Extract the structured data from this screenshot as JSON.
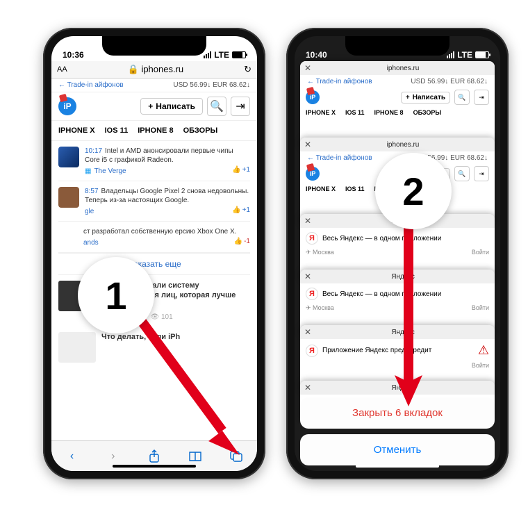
{
  "left": {
    "status_time": "10:36",
    "net": "LTE",
    "url_domain": "iphones.ru",
    "tradein_link": "← Trade-in айфонов",
    "rates": "USD 56.99↓ EUR 68.62↓",
    "write_btn": "Написать",
    "tabs": [
      "IPHONE X",
      "IOS 11",
      "IPHONE 8",
      "ОБЗОРЫ"
    ],
    "items": [
      {
        "time": "10:17",
        "title": "Intel и AMD анонсировали первые чипы Core i5 с графикой Radeon.",
        "source": "The Verge",
        "like": "+1"
      },
      {
        "time": "8:57",
        "title": "Владельцы Google Pixel 2 снова недовольны. Теперь из-за настоящих Google.",
        "source": "gle",
        "like": "+1"
      },
      {
        "time": "",
        "title": "ст разработал собственную ерсию Xbox One X.",
        "source": "ands",
        "like": "-1"
      }
    ],
    "showmore": "Показать еще",
    "article": {
      "title": "На CES показали систему распознавания лиц, которая лучше Face ID edit",
      "author": "Иван Петров",
      "views": "101"
    },
    "article2": "Что делать, если iPh"
  },
  "right": {
    "status_time": "10:40",
    "net": "LTE",
    "cards": {
      "iphones_domain": "iphones.ru",
      "tradein": "← Trade-in айфонов",
      "rates": "USD 56.99↓ EUR 68.62↓",
      "write": "Написать",
      "tabs": [
        "IPHONE X",
        "IOS 11",
        "IPHONE 8",
        "ОБЗОРЫ"
      ],
      "yandex_domain": "Яндекс",
      "yandex_line": "Весь Яндекс — в одном приложении",
      "yandex_line2": "Приложение Яндекс предупредит",
      "moscow": "Москва",
      "login": "Войти"
    },
    "sheet_close": "Закрыть 6 вкладок",
    "sheet_cancel": "Отменить"
  },
  "annotations": {
    "badge1": "1",
    "badge2": "2"
  }
}
